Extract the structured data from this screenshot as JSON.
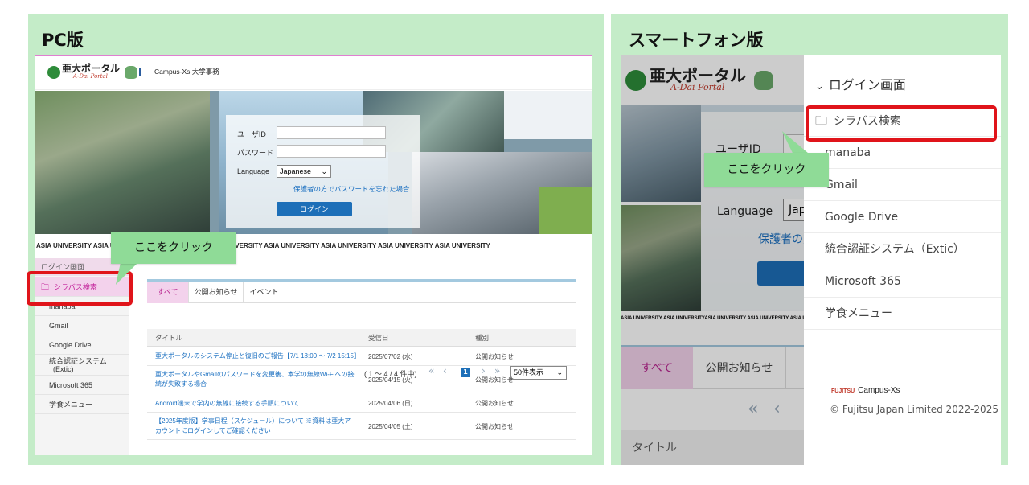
{
  "pc": {
    "label": "PC版",
    "logo": {
      "text": "亜大ポータル",
      "sub": "A-Dai Portal"
    },
    "header_brand": "Campus-Xs 大学事務",
    "login": {
      "user_label": "ユーザID",
      "password_label": "パスワード",
      "language_label": "Language",
      "language_value": "Japanese",
      "guardian_link": "保護者の方で",
      "forgot_link": "パスワードを忘れた場合",
      "login_button": "ログイン"
    },
    "ticker": "ASIA UNIVERSITY ASIA UNIVERSITY ASIA UNIVERSITY ASIA UNIVERSITY ASIA UNIVERSITY ASIA UNIVERSITY ASIA UNIVERSITY ASIA UNIVERSITY",
    "sidebar": {
      "header": "ログイン画面",
      "items": [
        "シラバス検索",
        "manaba",
        "Gmail",
        "Google Drive",
        "統合認証システム",
        "(Extic)",
        "Microsoft 365",
        "学食メニュー"
      ]
    },
    "tabs": [
      "すべて",
      "公開お知らせ",
      "イベント"
    ],
    "pager": {
      "range": "( 1 ～ 4 / 4 件中)",
      "current_page": "1",
      "per_page": "50件表示"
    },
    "table": {
      "headers": [
        "タイトル",
        "受信日",
        "種別"
      ],
      "rows": [
        {
          "title": "亜大ポータルのシステム停止と復旧のご報告【7/1 18:00 ～ 7/2 15:15】",
          "date": "2025/07/02 (水)",
          "type": "公開お知らせ"
        },
        {
          "title": "亜大ポータルやGmailのパスワードを変更後、本学の無線Wi-Fiへの接続が失敗する場合",
          "date": "2025/04/15 (火)",
          "type": "公開お知らせ"
        },
        {
          "title": "Android端末で学内の無線に接続する手順について",
          "date": "2025/04/06 (日)",
          "type": "公開お知らせ"
        },
        {
          "title": "【2025年度版】学事日程（スケジュール）について ※資料は亜大アカウントにログインしてご確認ください",
          "date": "2025/04/05 (土)",
          "type": "公開お知らせ"
        }
      ]
    },
    "callout": "ここをクリック"
  },
  "sp": {
    "label": "スマートフォン版",
    "logo": {
      "text": "亜大ポータル",
      "sub": "A-Dai Portal"
    },
    "login_peek": {
      "user_label": "ユーザID",
      "language_label": "Language",
      "language_value": "Jap",
      "guardian_link": "保護者の方"
    },
    "ticker": "ASIA UNIVERSITY ASIA UNIVERSITYASIA UNIVERSITY ASIA UNIVERSITY ASIA UNIVE",
    "tabs": [
      "すべて",
      "公開お知らせ"
    ],
    "table_header": "タイトル",
    "menu": {
      "header": "ログイン画面",
      "items": [
        "シラバス検索",
        "manaba",
        "Gmail",
        "Google Drive",
        "統合認証システム（Extic）",
        "Microsoft 365",
        "学食メニュー"
      ]
    },
    "footer": {
      "fujitsu": "FUJITSU",
      "brand": "Campus-Xs",
      "copyright": "© Fujitsu Japan Limited 2022-2025"
    },
    "callout": "ここをクリック"
  },
  "colors": {
    "panel_bg": "#c4ecc8",
    "callout_bg": "#8fdb97",
    "highlight_red": "#e0141a",
    "active_pink": "#f3d2ec",
    "link_blue": "#1a6fc0"
  }
}
